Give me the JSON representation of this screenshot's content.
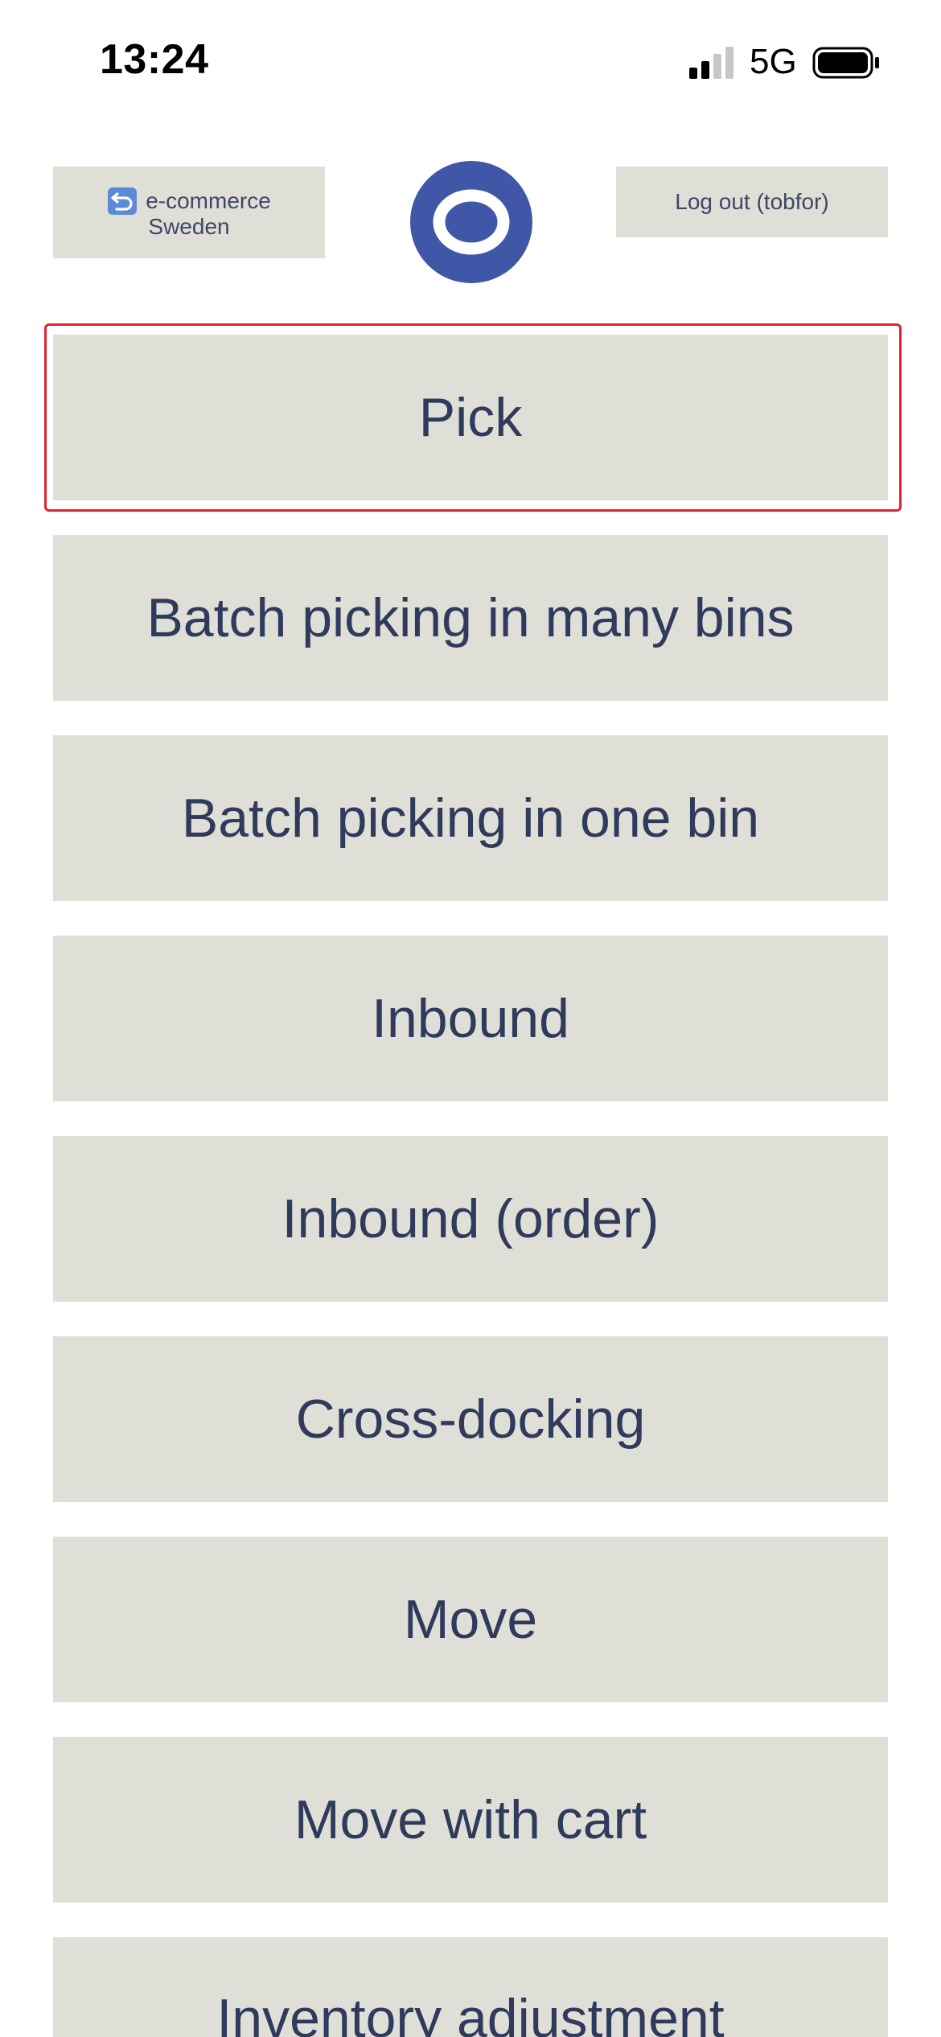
{
  "status_bar": {
    "time": "13:24",
    "network": "5G",
    "signal_icon": "cellular-signal-icon",
    "battery_icon": "battery-icon"
  },
  "header": {
    "company_label_line1": "e-commerce",
    "company_label_line2": "Sweden",
    "company_icon": "return-arrow-icon",
    "logout_label": "Log out (tobfor)",
    "logo_icon": "ring-logo-icon"
  },
  "menu": {
    "items": [
      {
        "label": "Pick"
      },
      {
        "label": "Batch picking in many bins"
      },
      {
        "label": "Batch picking in one bin"
      },
      {
        "label": "Inbound"
      },
      {
        "label": "Inbound (order)"
      },
      {
        "label": "Cross-docking"
      },
      {
        "label": "Move"
      },
      {
        "label": "Move with cart"
      },
      {
        "label": "Inventory adjustment"
      }
    ],
    "focused_index": 0
  },
  "colors": {
    "button_bg": "#e0dfd7",
    "button_text": "#2f3a5c",
    "logo_blue": "#3f57a6",
    "focus_ring": "#e0242e"
  }
}
